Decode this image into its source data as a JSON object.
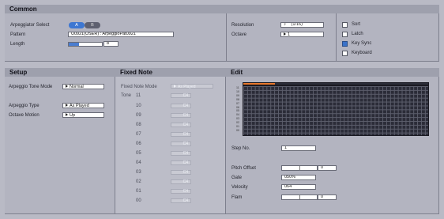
{
  "sections": {
    "common": "Common",
    "setup": "Setup",
    "fixed_note": "Fixed Note",
    "edit": "Edit"
  },
  "common": {
    "arp_select_label": "Arpeggiator Select",
    "arp_a": "A",
    "arp_b": "B",
    "pattern_label": "Pattern",
    "pattern_value": "U0921(USER) : ArpeggioPat0921",
    "length_label": "Length",
    "length_value": "8",
    "length_progress": 0.3,
    "resolution_label": "Resolution",
    "resolution_value": "(1/16)",
    "octave_label": "Octave",
    "octave_value": "1",
    "checkboxes": [
      {
        "label": "Sort",
        "checked": false
      },
      {
        "label": "Latch",
        "checked": false
      },
      {
        "label": "Key Sync",
        "checked": true
      },
      {
        "label": "Keyboard",
        "checked": false
      }
    ]
  },
  "setup": {
    "tone_mode_label": "Arpeggio Tone Mode",
    "tone_mode_value": "Normal",
    "type_label": "Arpeggio Type",
    "type_value": "As Played",
    "octave_motion_label": "Octave Motion",
    "octave_motion_value": "Up"
  },
  "fixed_note": {
    "mode_label": "Fixed Note Mode",
    "mode_value": "As Played",
    "tone_label": "Tone",
    "tone_header_num": "11",
    "tones": [
      "10",
      "09",
      "08",
      "07",
      "06",
      "05",
      "04",
      "03",
      "02",
      "01",
      "00"
    ],
    "tone_value": "C4"
  },
  "edit": {
    "grid_rows": [
      "11",
      "10",
      "09",
      "08",
      "07",
      "06",
      "05",
      "04",
      "03",
      "02",
      "01",
      "00"
    ],
    "step_no_label": "Step No.",
    "step_no_value": "1",
    "pitch_offset_label": "Pitch Offset",
    "pitch_offset_value": "0",
    "gate_label": "Gate",
    "gate_value": "050%",
    "velocity_label": "Velocity",
    "velocity_value": "064",
    "flam_label": "Flam",
    "flam_value": "0"
  },
  "colors": {
    "accent": "#3a72c9",
    "grid_bg": "#2b2c38",
    "progress": "#e8772b"
  }
}
